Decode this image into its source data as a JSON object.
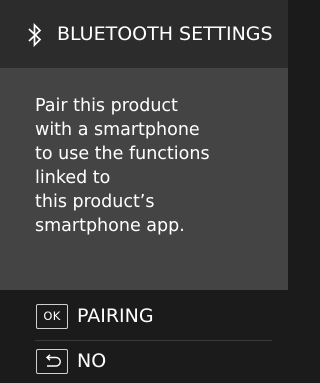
{
  "header": {
    "icon": "bluetooth-icon",
    "title": "BLUETOOTH SETTINGS"
  },
  "message": {
    "lines": [
      "Pair this product",
      "with a smartphone",
      "to use the functions",
      "linked to",
      "this product’s",
      "smartphone app."
    ]
  },
  "options": {
    "pairing": {
      "key_label": "OK",
      "label": "PAIRING"
    },
    "no": {
      "key_icon": "back-arrow-icon",
      "label": "NO"
    }
  },
  "colors": {
    "background": "#1b1b1b",
    "content_panel": "#444444",
    "header_bar": "#2c2c2c",
    "text": "#ffffff"
  }
}
